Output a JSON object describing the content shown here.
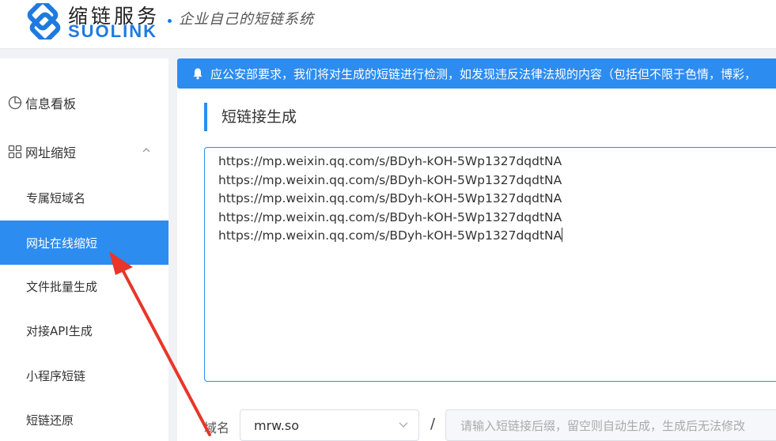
{
  "header": {
    "brand_cn": "缩链服务",
    "brand_en": "SUOLINK",
    "slogan": "企业自己的短链系统"
  },
  "sidebar": {
    "items": [
      {
        "label": "信息看板",
        "icon": "pie-chart-icon"
      },
      {
        "label": "网址缩短",
        "icon": "grid-icon",
        "expanded": true
      },
      {
        "label": "专属短域名"
      },
      {
        "label": "网址在线缩短",
        "active": true
      },
      {
        "label": "文件批量生成"
      },
      {
        "label": "对接API生成"
      },
      {
        "label": "小程序短链"
      },
      {
        "label": "短链还原"
      }
    ]
  },
  "notice": {
    "text": "应公安部要求，我们将对生成的短链进行检测，如发现违反法律法规的内容（包括但不限于色情，博彩，"
  },
  "main": {
    "section_title": "短链接生成",
    "urls": [
      "https://mp.weixin.qq.com/s/BDyh-kOH-5Wp1327dqdtNA",
      "https://mp.weixin.qq.com/s/BDyh-kOH-5Wp1327dqdtNA",
      "https://mp.weixin.qq.com/s/BDyh-kOH-5Wp1327dqdtNA",
      "https://mp.weixin.qq.com/s/BDyh-kOH-5Wp1327dqdtNA",
      "https://mp.weixin.qq.com/s/BDyh-kOH-5Wp1327dqdtNA"
    ],
    "domain_label": "域名",
    "domain_value": "mrw.so",
    "separator": "/",
    "suffix_placeholder": "请输入短链接后缀，留空则自动生成，生成后无法修改"
  },
  "colors": {
    "accent": "#2d8cf0",
    "annotation": "#e8362a"
  }
}
